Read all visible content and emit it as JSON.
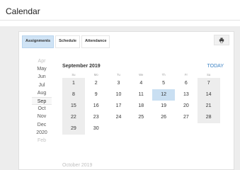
{
  "page": {
    "title": "Calendar"
  },
  "tabs": [
    {
      "label": "Assignments",
      "active": true
    },
    {
      "label": "Schedule",
      "active": false
    },
    {
      "label": "Attendance",
      "active": false
    }
  ],
  "toolbar": {
    "print_icon": "printer-icon"
  },
  "months": [
    {
      "label": "Apr",
      "faded": true
    },
    {
      "label": "May",
      "faded": false
    },
    {
      "label": "Jun",
      "faded": false
    },
    {
      "label": "Jul",
      "faded": false
    },
    {
      "label": "Aug",
      "faded": false
    },
    {
      "label": "Sep",
      "selected": true
    },
    {
      "label": "Oct",
      "faded": false
    },
    {
      "label": "Nov",
      "faded": false
    },
    {
      "label": "Dec",
      "faded": false
    },
    {
      "label": "2020",
      "faded": false
    },
    {
      "label": "Feb",
      "faded": true
    }
  ],
  "calendar": {
    "month_label": "September 2019",
    "today_label": "TODAY",
    "weekdays": [
      "Su",
      "Mo",
      "Tu",
      "We",
      "Th",
      "Fr",
      "Sa"
    ],
    "weeks": [
      [
        "1",
        "2",
        "3",
        "4",
        "5",
        "6",
        "7"
      ],
      [
        "8",
        "9",
        "10",
        "11",
        "12",
        "13",
        "14"
      ],
      [
        "15",
        "16",
        "17",
        "18",
        "19",
        "20",
        "21"
      ],
      [
        "22",
        "23",
        "24",
        "25",
        "26",
        "27",
        "28"
      ],
      [
        "29",
        "30"
      ]
    ],
    "today": "12",
    "next_month_label": "October 2019"
  },
  "colors": {
    "accent": "#3b82c4",
    "selected_tab": "#cfe3f5",
    "today_cell": "#c9dff2",
    "weekend_cell": "#ededed"
  }
}
